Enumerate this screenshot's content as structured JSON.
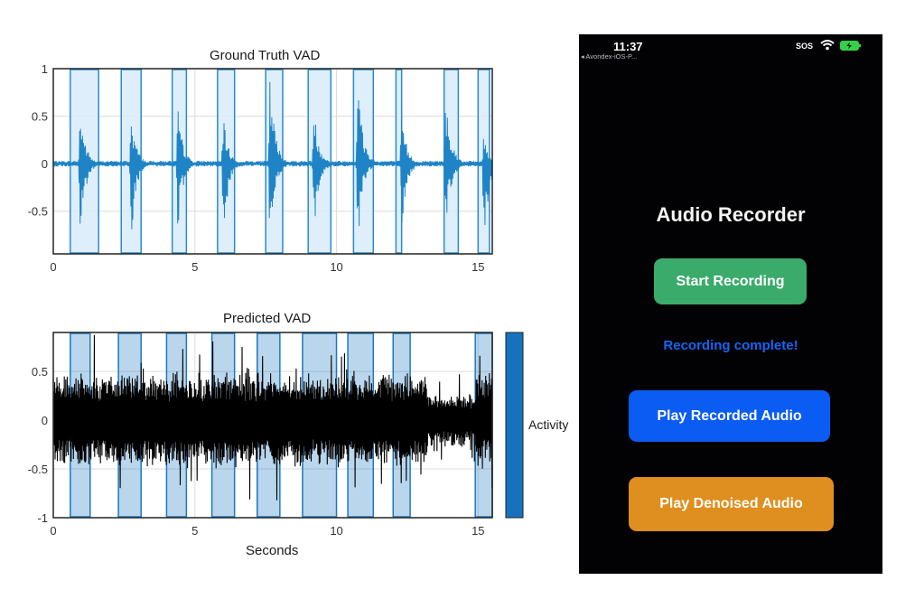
{
  "chart_data": [
    {
      "type": "line",
      "title": "Ground Truth VAD",
      "xlabel": "",
      "ylabel": "",
      "xlim": [
        0,
        15.5
      ],
      "ylim": [
        -0.95,
        1
      ],
      "x_ticks": [
        "0",
        "5",
        "10",
        "15"
      ],
      "x_tick_values": [
        0,
        5,
        10,
        15
      ],
      "y_ticks": [
        "1",
        "0.5",
        "0",
        "-0.5"
      ],
      "y_tick_values": [
        1,
        0.5,
        0,
        -0.5
      ],
      "grid": true,
      "signal_color": "#1f84c6",
      "region_color": "#d8ecfa",
      "region_edge_color": "#2a8ad0",
      "bursts": [
        {
          "t": 0.95,
          "peak": 0.62,
          "trough": -0.88
        },
        {
          "t": 2.75,
          "peak": 0.55,
          "trough": -0.82
        },
        {
          "t": 4.4,
          "peak": 0.6,
          "trough": -0.75
        },
        {
          "t": 6.0,
          "peak": 0.5,
          "trough": -0.8
        },
        {
          "t": 7.65,
          "peak": 0.95,
          "trough": -0.88
        },
        {
          "t": 9.2,
          "peak": 0.62,
          "trough": -0.8
        },
        {
          "t": 10.75,
          "peak": 0.95,
          "trough": -0.88
        },
        {
          "t": 12.3,
          "peak": 0.55,
          "trough": -0.75
        },
        {
          "t": 13.85,
          "peak": 0.85,
          "trough": -0.78
        },
        {
          "t": 15.2,
          "peak": 0.32,
          "trough": -0.9
        }
      ],
      "active_regions": [
        [
          0.6,
          1.6
        ],
        [
          2.4,
          3.1
        ],
        [
          4.2,
          4.7
        ],
        [
          5.8,
          6.4
        ],
        [
          7.5,
          8.1
        ],
        [
          9.0,
          9.8
        ],
        [
          10.6,
          11.3
        ],
        [
          12.1,
          12.3
        ],
        [
          13.8,
          14.3
        ],
        [
          15.0,
          15.4
        ]
      ]
    },
    {
      "type": "line",
      "title": "Predicted VAD",
      "xlabel": "Seconds",
      "ylabel": "",
      "xlim": [
        0,
        15.5
      ],
      "ylim": [
        -1,
        0.9
      ],
      "x_ticks": [
        "0",
        "5",
        "10",
        "15"
      ],
      "x_tick_values": [
        0,
        5,
        10,
        15
      ],
      "y_ticks": [
        "0.5",
        "0",
        "-0.5",
        "-1"
      ],
      "y_tick_values": [
        0.5,
        0,
        -0.5,
        -1
      ],
      "grid": true,
      "signal_color": "#000000",
      "region_color": "#1c78c0",
      "region_edge_color": "#1c78c0",
      "colorbar_label": "Activity",
      "colorbar_color": "#1672bd",
      "active_regions": [
        [
          0.6,
          1.3
        ],
        [
          2.3,
          3.1
        ],
        [
          4.0,
          4.7
        ],
        [
          5.6,
          6.4
        ],
        [
          7.2,
          8.0
        ],
        [
          8.8,
          10.0
        ],
        [
          10.4,
          11.3
        ],
        [
          12.0,
          12.6
        ],
        [
          14.9,
          15.5
        ]
      ]
    }
  ],
  "phone": {
    "status_time": "11:37",
    "back_label": "◂ Avondex-iOS-P...",
    "sos": "SOS",
    "app_title": "Audio Recorder",
    "start_button": "Start Recording",
    "status_message": "Recording complete!",
    "play_recorded_button": "Play Recorded Audio",
    "play_denoised_button": "Play Denoised Audio",
    "colors": {
      "background": "#020204",
      "start_button": "#3aab6b",
      "play_button": "#0b5cf2",
      "denoise_button": "#df8f1f",
      "status_text": "#1565f5",
      "battery": "#35d04a"
    }
  }
}
